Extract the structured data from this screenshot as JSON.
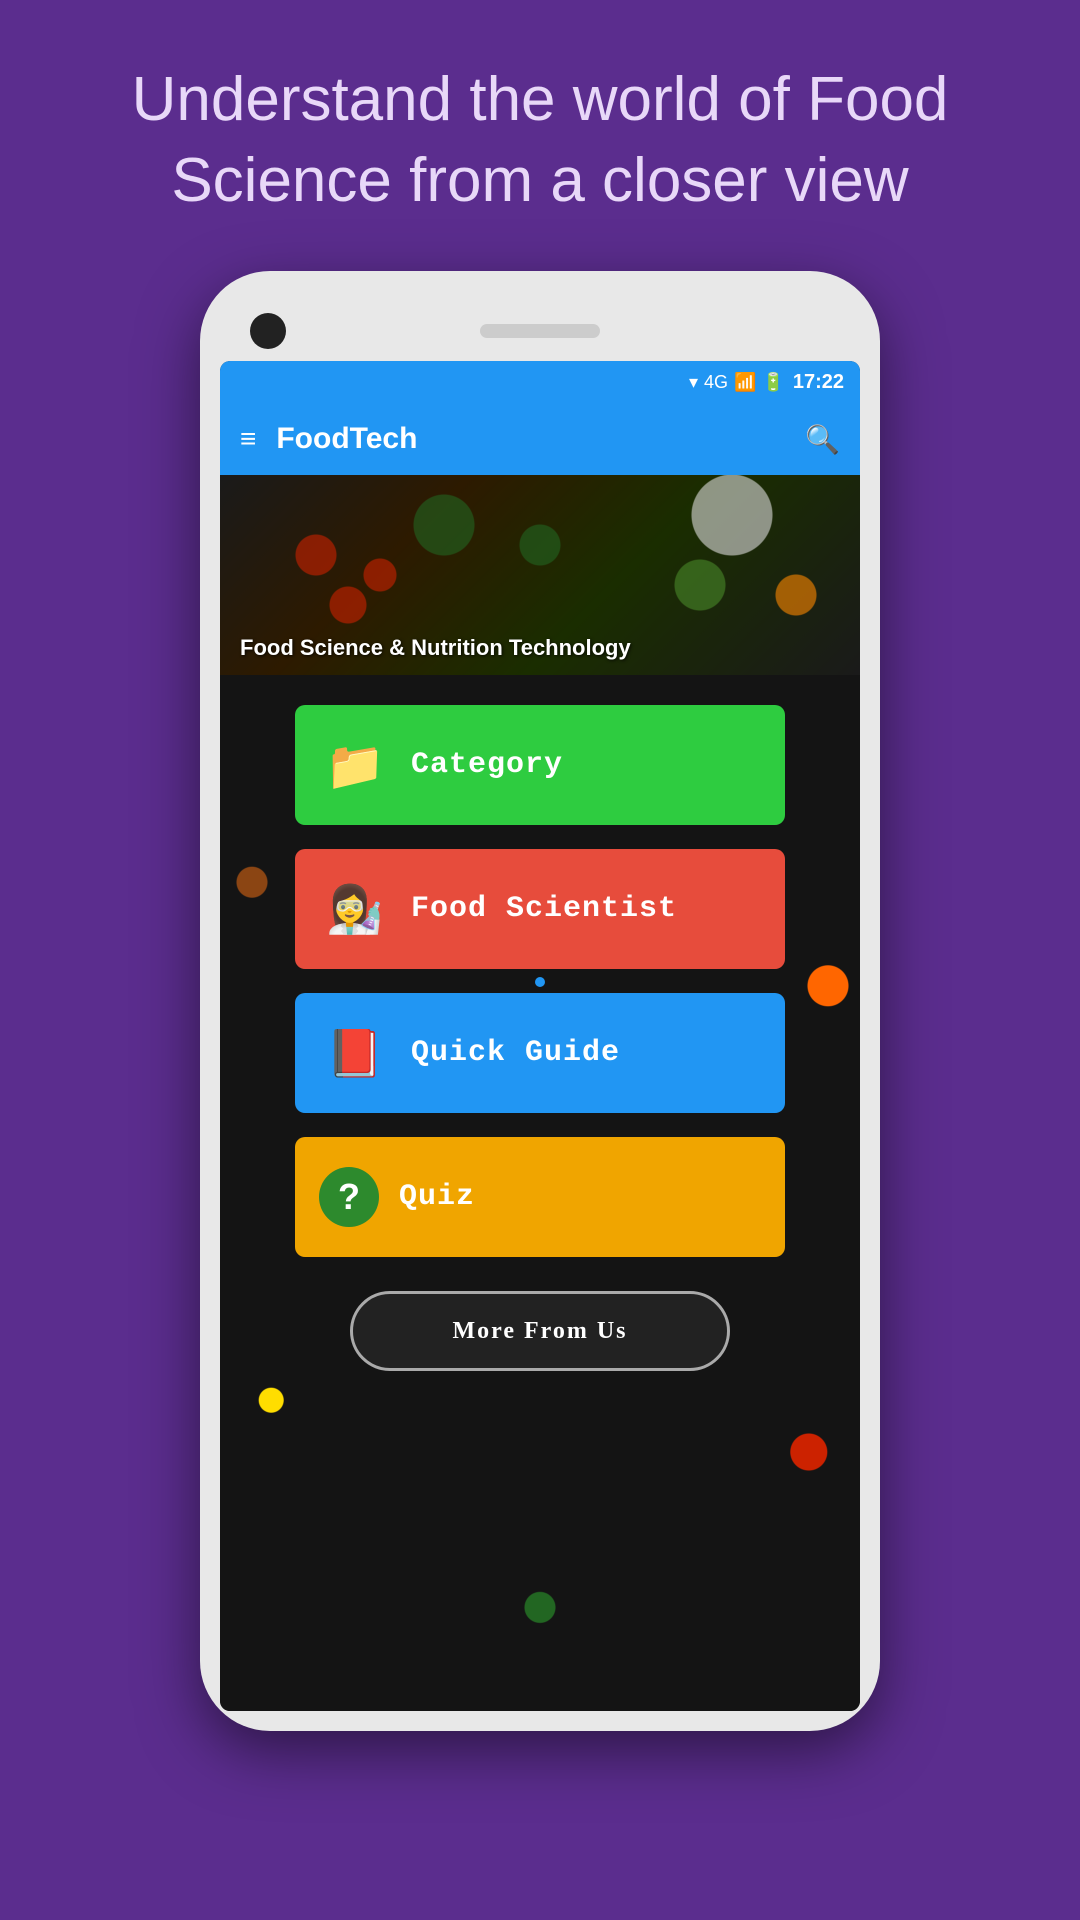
{
  "page": {
    "background_color": "#5b2d8e"
  },
  "header": {
    "title": "Understand the world of Food Science from a closer view"
  },
  "status_bar": {
    "time": "17:22",
    "wifi_icon": "wifi",
    "signal_icon": "4G",
    "battery_icon": "battery"
  },
  "app_bar": {
    "title": "FoodTech",
    "menu_icon": "≡",
    "search_icon": "🔍"
  },
  "hero": {
    "subtitle": "Food Science & Nutrition Technology"
  },
  "buttons": [
    {
      "id": "category",
      "label": "Category",
      "icon": "📁",
      "color": "#2ecc40"
    },
    {
      "id": "food-scientist",
      "label": "Food Scientist",
      "icon": "👩‍🔬",
      "color": "#e74c3c"
    },
    {
      "id": "quick-guide",
      "label": "Quick Guide",
      "icon": "📕",
      "color": "#2196F3"
    },
    {
      "id": "quiz",
      "label": "Quiz",
      "icon": "❓",
      "color": "#f0a500"
    }
  ],
  "more_button": {
    "label": "More From Us"
  }
}
